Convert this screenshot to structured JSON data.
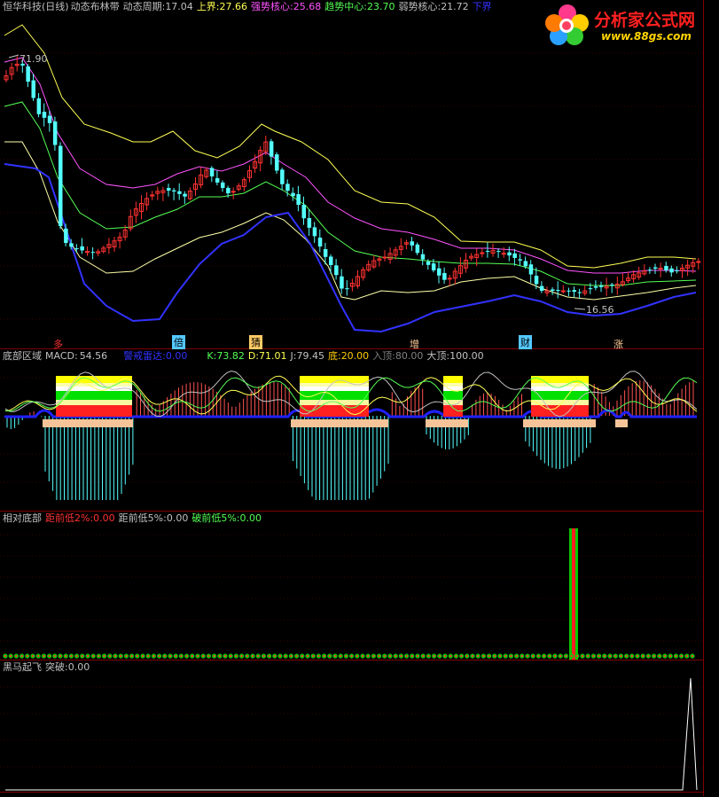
{
  "colors": {
    "up": "#ff3232",
    "down": "#54ffff",
    "upper": "#ffff54",
    "strong": "#ff54ff",
    "mid": "#54ff54",
    "weak": "#ffffa8",
    "lower": "#3232ff",
    "grid": "#800000"
  },
  "panel1": {
    "title": "恒华科技(日线)",
    "indicator": "动态布林带",
    "period_label": "动态周期:",
    "period_value": "17.04",
    "upper_label": "上界:",
    "upper_value": "27.66",
    "strong_label": "强势核心:",
    "strong_value": "25.68",
    "mid_label": "趋势中心:",
    "mid_value": "23.70",
    "weak_label": "弱势核心:",
    "weak_value": "21.72",
    "lower_label": "下界",
    "high_marker": "71.90",
    "low_marker": "16.56",
    "signals": [
      "多",
      "倍",
      "猜",
      "增",
      "财",
      "涨"
    ]
  },
  "panel2": {
    "title": "底部区域",
    "macd_label": "MACD:",
    "macd_value": "54.56",
    "warn_label": "警戒雷达:",
    "warn_value": "0.00",
    "k_label": "K:",
    "k_value": "73.82",
    "d_label": "D:",
    "d_value": "71.01",
    "j_label": "J:",
    "j_value": "79.45",
    "bottom_label": "底:",
    "bottom_value": "20.00",
    "entry_label": "入顶:",
    "entry_value": "80.00",
    "top_label": "大顶:",
    "top_value": "100.00"
  },
  "panel3": {
    "title": "相对底部",
    "l1": "距前低2%:",
    "v1": "0.00",
    "l2": "距前低5%:",
    "v2": "0.00",
    "l3": "破前低5%:",
    "v3": "0.00"
  },
  "panel4": {
    "title": "黑马起飞",
    "l1": "突破:",
    "v1": "0.00"
  },
  "logo": {
    "title": "分析家公式网",
    "url": "www.88gs.com"
  },
  "chart_data": {
    "type": "candlestick",
    "title": "恒华科技(日线)",
    "series": [
      {
        "name": "上界",
        "last": 27.66
      },
      {
        "name": "强势核心",
        "last": 25.68
      },
      {
        "name": "趋势中心",
        "last": 23.7
      },
      {
        "name": "弱势核心",
        "last": 21.72
      },
      {
        "name": "下界"
      }
    ],
    "annotations": [
      {
        "label": "71.90"
      },
      {
        "label": "16.56"
      }
    ]
  }
}
